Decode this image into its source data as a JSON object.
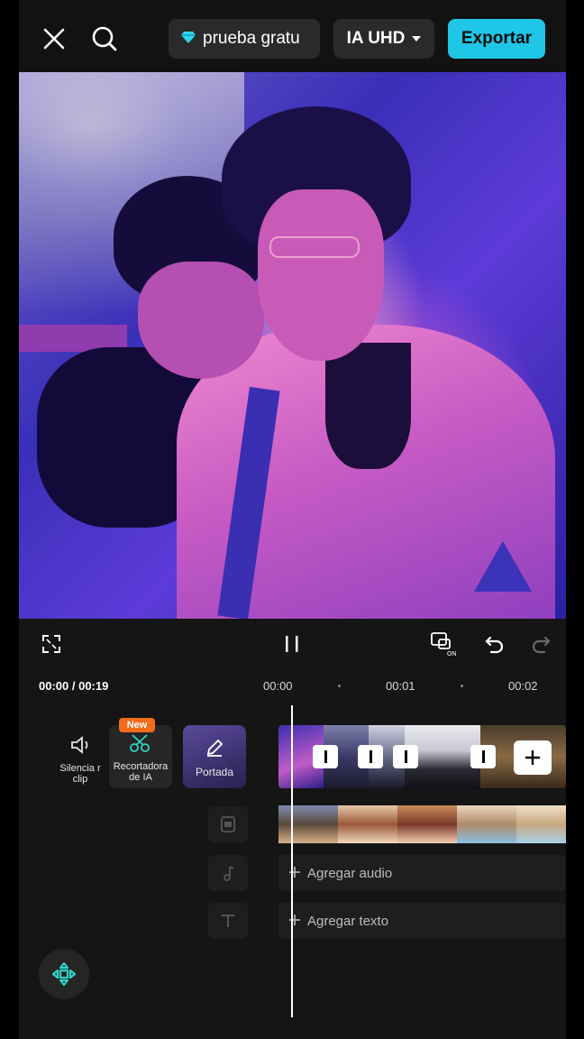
{
  "topbar": {
    "close_icon": "close-icon",
    "search_icon": "search-icon",
    "trial_label": "prueba gratu",
    "trial_icon": "diamond-icon",
    "quality_label": "IA UHD",
    "export_label": "Exportar",
    "accent_color": "#1fc6e6"
  },
  "controls": {
    "fullscreen_icon": "fullscreen-icon",
    "pause_icon": "pause-icon",
    "keyframe_icon": "keyframe-on-icon",
    "undo_icon": "undo-icon",
    "redo_icon": "redo-icon"
  },
  "ruler": {
    "current": "00:00 / 00:19",
    "ticks": [
      "00:00",
      "00:01",
      "00:02"
    ]
  },
  "tools": {
    "mute": {
      "label": "Silencia r clip",
      "icon": "speaker-icon"
    },
    "cutout": {
      "label": "Recortadora de IA",
      "badge": "New",
      "icon": "scissors-icon"
    },
    "cover": {
      "label": "Portada",
      "icon": "pencil-icon"
    }
  },
  "tracks": {
    "audio_label": "Agregar audio",
    "text_label": "Agregar texto",
    "overlay_icon": "overlay-icon",
    "music_icon": "music-note-icon",
    "text_icon": "text-icon"
  },
  "fab_icon": "move-cross-icon"
}
